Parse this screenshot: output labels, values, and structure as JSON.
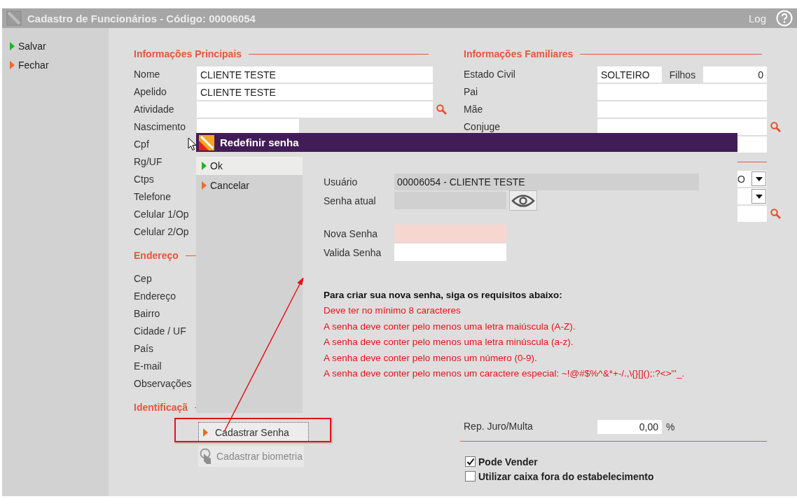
{
  "window": {
    "title": "Cadastro de Funcionários - Código: 00006054",
    "log": "Log"
  },
  "sidebar": {
    "actions": [
      {
        "label": "Salvar",
        "kind": "confirm"
      },
      {
        "label": "Fechar",
        "kind": "cancel"
      }
    ]
  },
  "left_sections": [
    {
      "heading": "Informações Principais",
      "fields": [
        {
          "label": "Nome",
          "kind": "text",
          "value": "CLIENTE TESTE"
        },
        {
          "label": "Apelido",
          "kind": "text",
          "value": "CLIENTE TESTE"
        },
        {
          "label": "Atividade",
          "kind": "search"
        },
        {
          "label": "Nascimento",
          "kind": "short"
        },
        {
          "label": "Cpf",
          "kind": "label"
        },
        {
          "label": "Rg/UF",
          "kind": "label"
        },
        {
          "label": "Ctps",
          "kind": "label"
        },
        {
          "label": "Telefone",
          "kind": "label"
        },
        {
          "label": "Celular 1/Op",
          "kind": "label"
        },
        {
          "label": "Celular 2/Op",
          "kind": "label"
        }
      ]
    },
    {
      "heading": "Endereço",
      "fields": [
        {
          "label": "Cep",
          "kind": "label"
        },
        {
          "label": "Endereço",
          "kind": "label"
        },
        {
          "label": "Bairro",
          "kind": "label"
        },
        {
          "label": "Cidade / UF",
          "kind": "label"
        },
        {
          "label": "País",
          "kind": "label"
        },
        {
          "label": "E-mail",
          "kind": "label"
        },
        {
          "label": "Observações",
          "kind": "label"
        }
      ]
    },
    {
      "heading": "Identificaçã"
    }
  ],
  "bottom_buttons": [
    {
      "label": "Cadastrar Senha",
      "disabled": false,
      "annotated": true
    },
    {
      "label": "Cadastrar biometria",
      "disabled": true,
      "annotated": false
    }
  ],
  "family": {
    "heading": "Informações Familiares",
    "fields": [
      {
        "label": "Estado Civil",
        "kind": "pair",
        "value": "SOLTEIRO",
        "label_2": "Filhos",
        "value_2": "0"
      },
      {
        "label": "Pai",
        "kind": "text"
      },
      {
        "label": "Mãe",
        "kind": "text"
      },
      {
        "label": "Conjuge",
        "kind": "search"
      }
    ]
  },
  "covered_rows": [
    {
      "kind": "text"
    },
    {
      "kind": "rule"
    },
    {
      "kind": "select",
      "value": "O"
    },
    {
      "kind": "select"
    },
    {
      "kind": "search"
    }
  ],
  "rate": {
    "label": "Rep. Juro/Multa",
    "value": "0,00",
    "unit": "%"
  },
  "checkboxes": [
    {
      "label": "Pode Vender",
      "checked": true
    },
    {
      "label": "Utilizar caixa fora do estabelecimento",
      "checked": false
    }
  ],
  "dialog": {
    "title": "Redefinir senha",
    "actions": [
      {
        "label": "Ok",
        "kind": "confirm",
        "selected": true
      },
      {
        "label": "Cancelar",
        "kind": "cancel",
        "selected": false
      }
    ],
    "fields": [
      {
        "label": "Usuário",
        "kind": "readonly-wide",
        "value": "00006054 - CLIENTE TESTE"
      },
      {
        "label": "Senha atual",
        "kind": "reveal"
      },
      {
        "label": "Nova Senha",
        "kind": "invalid"
      },
      {
        "label": "Valida Senha",
        "kind": "plain"
      }
    ],
    "requirements": {
      "heading": "Para criar sua nova senha, siga os requisitos abaixo:",
      "items": [
        "Deve ter no mínimo 8 caracteres",
        "A senha deve conter pelo menos uma letra maiúscula (A-Z).",
        "A senha deve conter pelo menos uma letra minúscula (a-z).",
        "A senha deve conter pelo menos um número (0-9).",
        "A senha deve conter pelo menos um caractere especial: ~!@#$%^&*+-/.,\\{}[]();:?<>\"'_."
      ]
    }
  }
}
